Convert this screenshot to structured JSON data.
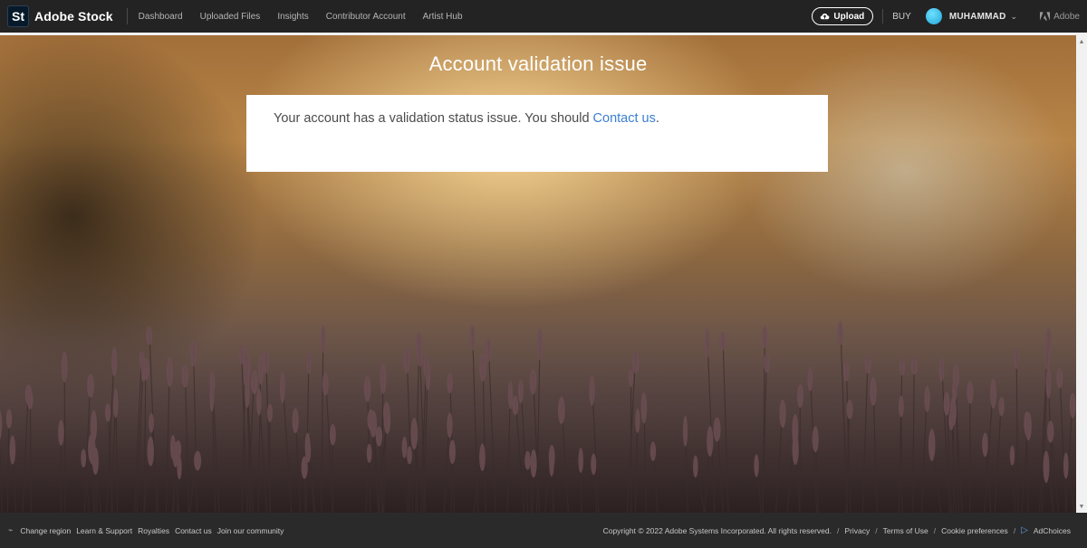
{
  "header": {
    "logo_badge": "St",
    "brand": "Adobe Stock",
    "nav": [
      "Dashboard",
      "Uploaded Files",
      "Insights",
      "Contributor Account",
      "Artist Hub"
    ],
    "upload_label": "Upload",
    "buy_label": "BUY",
    "user_name": "MUHAMMAD",
    "adobe_label": "Adobe"
  },
  "main": {
    "title": "Account validation issue",
    "message": "Your account has a validation status issue. You should ",
    "contact_link": "Contact us",
    "message_end": "."
  },
  "footer": {
    "left_links": [
      "Change region",
      "Learn & Support",
      "Royalties",
      "Contact us",
      "Join our community"
    ],
    "copyright": "Copyright © 2022 Adobe Systems Incorporated. All rights reserved.",
    "right_links": [
      "Privacy",
      "Terms of Use",
      "Cookie preferences",
      "AdChoices"
    ],
    "separator": "/"
  },
  "colors": {
    "header_bg": "#232323",
    "footer_bg": "#2a2a2a",
    "link_blue": "#3a7ed1",
    "avatar": "#1fa6d6"
  },
  "icons": {
    "upload": "cloud-upload-icon",
    "adobe": "adobe-logo-icon",
    "region": "globe-icon",
    "adchoices": "adchoices-icon"
  }
}
